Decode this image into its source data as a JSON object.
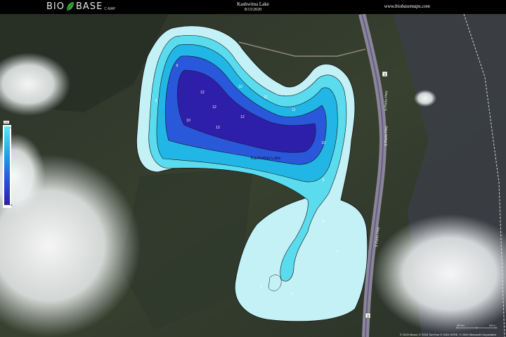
{
  "header": {
    "logo_text_left": "BIO",
    "logo_text_right": "BASE",
    "logo_sub": "C-MAP",
    "lake_name": "Kashwitna Lake",
    "date": "8/13/2020",
    "website": "www.biobasemaps.com"
  },
  "legend": {
    "title": "LRG",
    "top_label": "1'",
    "bottom_label": "13'"
  },
  "map": {
    "lake_label": "Kashwitna Lake",
    "road_labels": [
      "S Parks Hwy",
      "S Parks Hwy",
      "S Parks Hwy"
    ],
    "route_shields": [
      "3",
      "3"
    ],
    "depth_labels": [
      "12",
      "10",
      "12",
      "12",
      "11",
      "10",
      "12",
      "11",
      "10",
      "9",
      "9",
      "9",
      "8",
      "7",
      "6",
      "5"
    ],
    "colors": {
      "shallow": "#bff3f7",
      "light": "#56e0ef",
      "mid": "#1fb7e8",
      "deep": "#2455d9",
      "deepest": "#2c1ea6",
      "contour": "#1a1a1a"
    }
  },
  "scale": {
    "left_label": "240 feet",
    "right_label": "100 m"
  },
  "attribution": "© 2020 Maxar, © 2020 TomTom © 2020 HERE, © 2020 Microsoft Corporation"
}
